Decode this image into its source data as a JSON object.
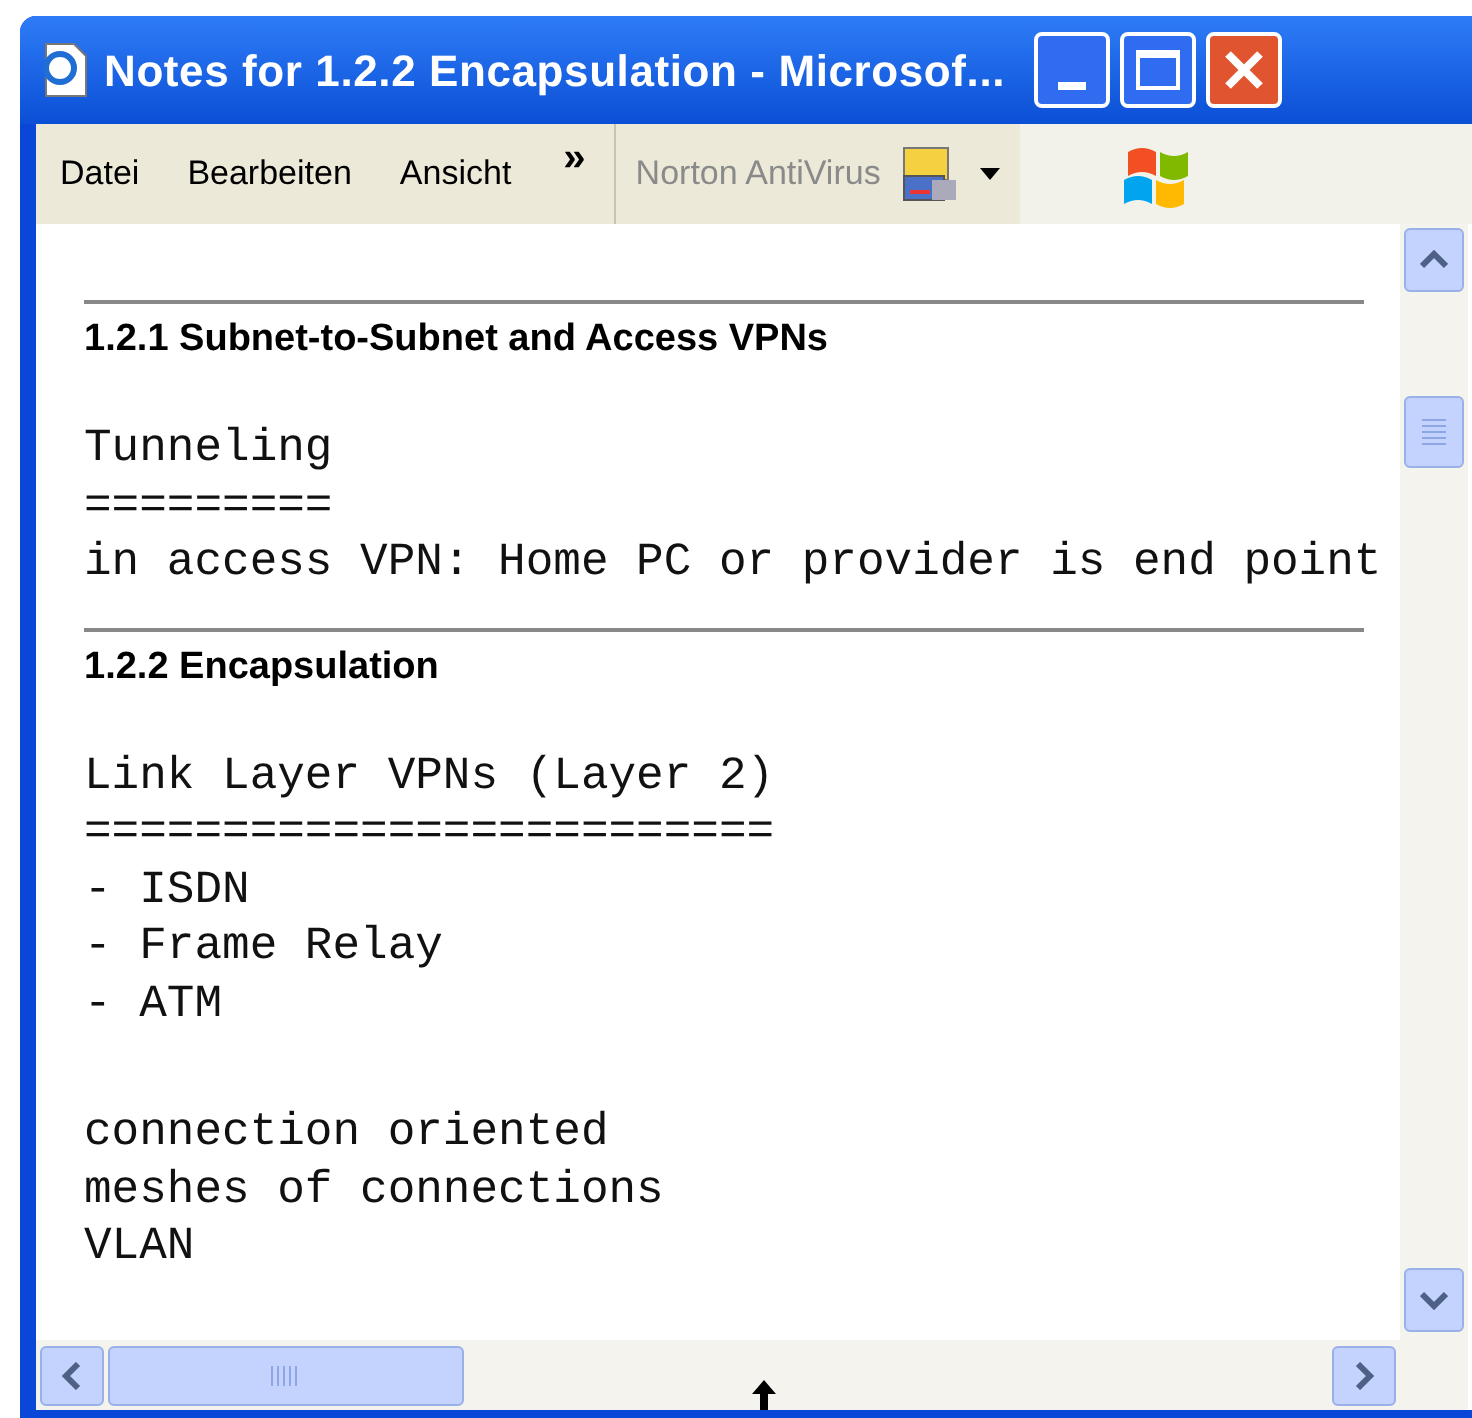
{
  "window": {
    "title": "Notes for 1.2.2 Encapsulation - Microsof..."
  },
  "menu": [
    {
      "label": "Datei"
    },
    {
      "label": "Bearbeiten"
    },
    {
      "label": "Ansicht"
    }
  ],
  "toolbar": {
    "overflow": "»",
    "norton_label": "Norton AntiVirus",
    "norton_disabled": true
  },
  "content": [
    {
      "kind": "heading",
      "text": "1.2.1 Subnet-to-Subnet and Access VPNs"
    },
    {
      "kind": "text",
      "lines": [
        "Tunneling",
        "=========",
        "in access VPN: Home PC or provider is end point"
      ]
    },
    {
      "kind": "heading",
      "text": "1.2.2 Encapsulation"
    },
    {
      "kind": "text",
      "lines": [
        "Link Layer VPNs (Layer 2)",
        "=========================",
        "- ISDN",
        "- Frame Relay",
        "- ATM"
      ]
    },
    {
      "kind": "text",
      "lines": [
        "connection oriented",
        "meshes of connections",
        "VLAN"
      ]
    }
  ]
}
